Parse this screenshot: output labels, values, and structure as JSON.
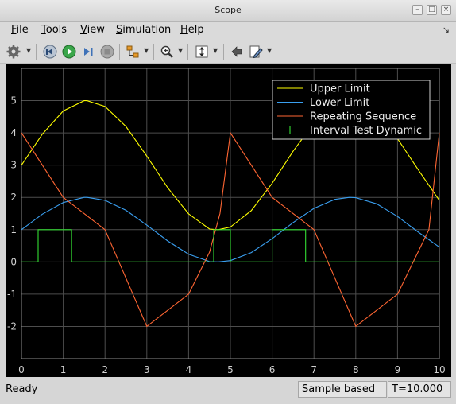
{
  "window": {
    "title": "Scope"
  },
  "menu": {
    "items": [
      {
        "label": "File",
        "key": "F",
        "rest": "ile"
      },
      {
        "label": "Tools",
        "key": "T",
        "rest": "ools"
      },
      {
        "label": "View",
        "key": "V",
        "rest": "iew"
      },
      {
        "label": "Simulation",
        "key": "S",
        "rest": "imulation"
      },
      {
        "label": "Help",
        "key": "H",
        "rest": "elp"
      }
    ]
  },
  "toolbar": {
    "icons": [
      "gear-icon",
      "step-back-icon",
      "run-icon",
      "step-forward-icon",
      "stop-icon",
      "highlight-icon",
      "zoom-in-icon",
      "autoscale-icon",
      "restore-icon",
      "edit-icon"
    ]
  },
  "status": {
    "left": "Ready",
    "mode": "Sample based",
    "time": "T=10.000"
  },
  "chart_data": {
    "type": "line",
    "xlim": [
      0,
      10
    ],
    "ylim": [
      -3,
      6
    ],
    "xticks": [
      "0",
      "1",
      "2",
      "3",
      "4",
      "5",
      "6",
      "7",
      "8",
      "9",
      "10"
    ],
    "yticks": [
      "-2",
      "-1",
      "0",
      "1",
      "2",
      "3",
      "4",
      "5"
    ],
    "ytick_values": [
      -2,
      -1,
      0,
      1,
      2,
      3,
      4,
      5
    ],
    "grid": true,
    "legend_position": "top-right",
    "background": "#000000",
    "series": [
      {
        "name": "Upper Limit",
        "color": "#ffff00",
        "style": "line",
        "x": [
          0,
          0.5,
          1,
          1.5,
          1.57,
          2,
          2.5,
          3,
          3.5,
          4,
          4.5,
          4.71,
          5,
          5.5,
          6,
          6.5,
          7,
          7.5,
          7.85,
          8,
          8.5,
          9,
          9.5,
          10
        ],
        "y": [
          3,
          3.96,
          4.68,
          5,
          5,
          4.82,
          4.2,
          3.28,
          2.3,
          1.49,
          1.02,
          1,
          1.08,
          1.59,
          2.44,
          3.43,
          4.31,
          4.87,
          5,
          4.98,
          4.6,
          3.82,
          2.85,
          1.91
        ]
      },
      {
        "name": "Lower Limit",
        "color": "#3a9ff0",
        "style": "line",
        "x": [
          0,
          0.5,
          1,
          1.5,
          1.57,
          2,
          2.5,
          3,
          3.5,
          4,
          4.5,
          4.71,
          5,
          5.5,
          6,
          6.5,
          7,
          7.5,
          7.85,
          8,
          8.5,
          9,
          9.5,
          10
        ],
        "y": [
          1,
          1.48,
          1.84,
          2,
          2,
          1.91,
          1.6,
          1.14,
          0.65,
          0.24,
          0.01,
          0,
          0.04,
          0.29,
          0.72,
          1.22,
          1.66,
          1.94,
          2,
          1.99,
          1.8,
          1.41,
          0.92,
          0.46
        ]
      },
      {
        "name": "Repeating Sequence",
        "color": "#ff6633",
        "style": "line",
        "x": [
          0,
          1,
          2,
          3,
          4,
          4.5,
          4.75,
          5,
          6,
          7,
          8,
          9,
          9.75,
          10
        ],
        "y": [
          4,
          2,
          1,
          -2,
          -1,
          0.3,
          1.5,
          4,
          2,
          1,
          -2,
          -1,
          1,
          4
        ]
      },
      {
        "name": "Interval Test Dynamic",
        "color": "#33dd33",
        "style": "step",
        "x": [
          0,
          0.4,
          0.4,
          1.2,
          1.2,
          4.6,
          4.6,
          5.0,
          5.0,
          6.0,
          6.0,
          6.8,
          6.8,
          10
        ],
        "y": [
          0,
          0,
          1,
          1,
          0,
          0,
          1,
          1,
          0,
          0,
          1,
          1,
          0,
          0
        ]
      }
    ]
  }
}
